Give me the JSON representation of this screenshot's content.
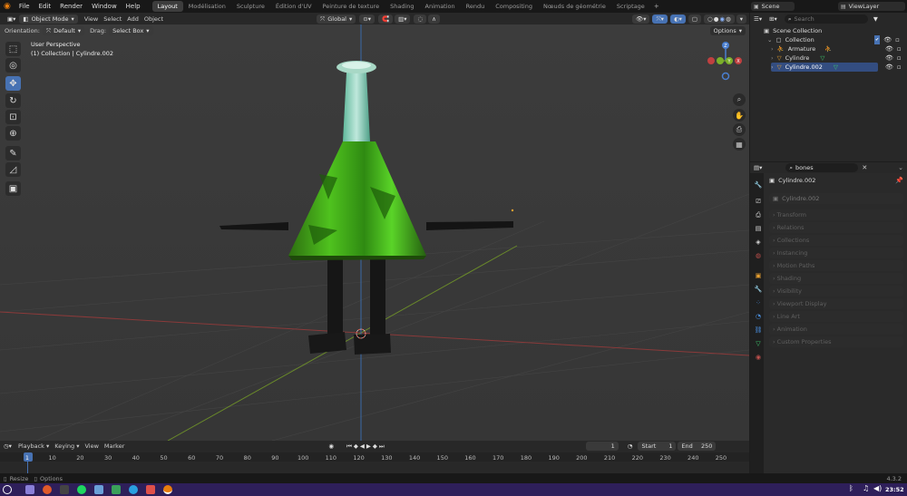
{
  "app": {
    "menus": [
      "File",
      "Edit",
      "Render",
      "Window",
      "Help"
    ],
    "workspaces": [
      "Layout",
      "Modélisation",
      "Sculpture",
      "Édition d'UV",
      "Peinture de texture",
      "Shading",
      "Animation",
      "Rendu",
      "Compositing",
      "Nœuds de géométrie",
      "Scriptage"
    ],
    "active_workspace": "Layout",
    "scene": "Scene",
    "view_layer": "ViewLayer"
  },
  "viewport_header": {
    "mode": "Object Mode",
    "menus": [
      "View",
      "Select",
      "Add",
      "Object"
    ],
    "transform": "Global",
    "orientation_label": "Orientation:",
    "orientation": "Default",
    "drag_label": "Drag:",
    "drag": "Select Box",
    "options": "Options"
  },
  "viewport": {
    "perspective": "User Perspective",
    "collection_info": "(1) Collection | Cylindre.002",
    "axes": {
      "z": "Z",
      "y": "Y",
      "x": "X"
    }
  },
  "outliner": {
    "search_placeholder": "Search",
    "root": "Scene Collection",
    "collection": "Collection",
    "items": [
      "Armature",
      "Cylindre",
      "Cylindre.002"
    ]
  },
  "properties": {
    "search": "bones",
    "object": "Cylindre.002",
    "data": "Cylindre.002",
    "sections": [
      "Transform",
      "Relations",
      "Collections",
      "Instancing",
      "Motion Paths",
      "Shading",
      "Visibility",
      "Viewport Display",
      "Line Art",
      "Animation",
      "Custom Properties"
    ]
  },
  "timeline": {
    "menus": [
      "Playback",
      "Keying",
      "View",
      "Marker"
    ],
    "current_frame": "1",
    "start_label": "Start",
    "start": "1",
    "end_label": "End",
    "end": "250",
    "ticks": [
      "1",
      "10",
      "20",
      "30",
      "40",
      "50",
      "60",
      "70",
      "80",
      "90",
      "100",
      "110",
      "120",
      "130",
      "140",
      "150",
      "160",
      "170",
      "180",
      "190",
      "200",
      "210",
      "220",
      "230",
      "240",
      "250"
    ]
  },
  "statusbar": {
    "resize": "Resize",
    "options": "Options",
    "version": "4.3.2"
  },
  "taskbar": {
    "time": "23:52"
  }
}
